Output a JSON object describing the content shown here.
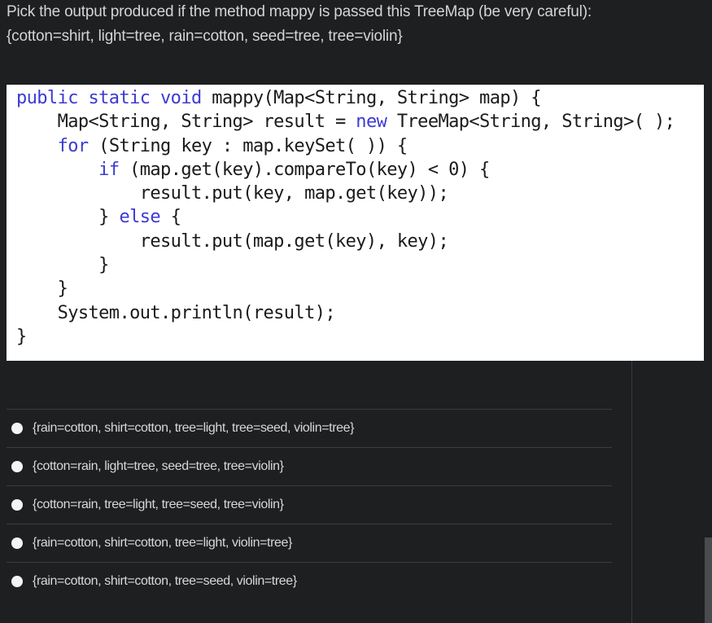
{
  "question": {
    "prompt": "Pick the output produced if the method mappy is passed this TreeMap (be very careful):",
    "input_map": "{cotton=shirt, light=tree, rain=cotton, seed=tree, tree=violin}"
  },
  "code": {
    "lines": [
      [
        {
          "t": "public static void",
          "k": true
        },
        {
          "t": " mappy(Map<String, String> map) {"
        }
      ],
      [
        {
          "t": "    Map<String, String> result = "
        },
        {
          "t": "new",
          "k": true
        },
        {
          "t": " TreeMap<String, String>( );"
        }
      ],
      [
        {
          "t": "    "
        },
        {
          "t": "for",
          "k": true
        },
        {
          "t": " (String key : map.keySet( )) {"
        }
      ],
      [
        {
          "t": "        "
        },
        {
          "t": "if",
          "k": true
        },
        {
          "t": " (map.get(key).compareTo(key) < 0) {"
        }
      ],
      [
        {
          "t": "            result.put(key, map.get(key));"
        }
      ],
      [
        {
          "t": "        } "
        },
        {
          "t": "else",
          "k": true
        },
        {
          "t": " {"
        }
      ],
      [
        {
          "t": "            result.put(map.get(key), key);"
        }
      ],
      [
        {
          "t": "        }"
        }
      ],
      [
        {
          "t": "    }"
        }
      ],
      [
        {
          "t": "    System.out.println(result);"
        }
      ],
      [
        {
          "t": "}"
        }
      ]
    ]
  },
  "options": [
    {
      "label": "{rain=cotton, shirt=cotton, tree=light, tree=seed, violin=tree}"
    },
    {
      "label": "{cotton=rain, light=tree, seed=tree, tree=violin}"
    },
    {
      "label": "{cotton=rain, tree=light, tree=seed, tree=violin}"
    },
    {
      "label": "{rain=cotton, shirt=cotton, tree=light, violin=tree}"
    },
    {
      "label": "{rain=cotton, shirt=cotton, tree=seed, violin=tree}"
    }
  ],
  "colors": {
    "background": "#1e1f21",
    "keyword": "#3d3ad3",
    "code_background": "#ffffff"
  }
}
